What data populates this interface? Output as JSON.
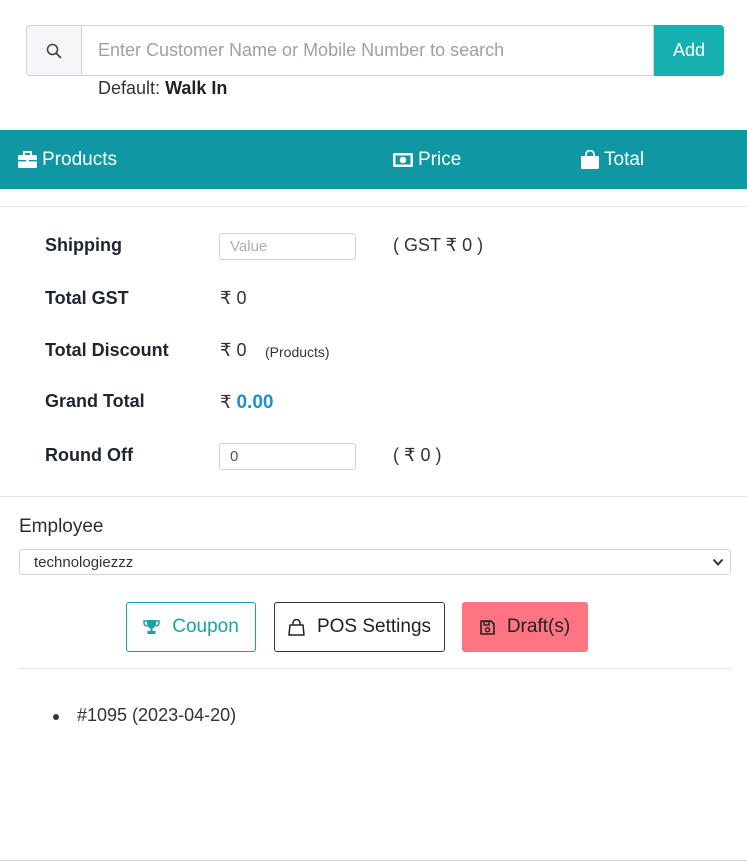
{
  "search": {
    "placeholder": "Enter Customer Name or Mobile Number to search",
    "add_label": "Add",
    "icon": "search-icon"
  },
  "customer": {
    "default_prefix": "Default:",
    "default_value": "Walk In"
  },
  "table_header": {
    "products": "Products",
    "price": "Price",
    "total": "Total",
    "background": "#0f97a3"
  },
  "summary": {
    "shipping": {
      "label": "Shipping",
      "placeholder": "Value",
      "gst_note": "( GST ₹ 0 )"
    },
    "total_gst": {
      "label": "Total GST",
      "value": "₹ 0"
    },
    "total_discount": {
      "label": "Total Discount",
      "value": "₹ 0",
      "note": "(Products)"
    },
    "grand_total": {
      "label": "Grand Total",
      "currency": "₹",
      "value": "0.00"
    },
    "round_off": {
      "label": "Round Off",
      "value": "0",
      "note": "( ₹ 0 )"
    }
  },
  "employee": {
    "label": "Employee",
    "selected": "technologiezzz"
  },
  "actions": {
    "coupon": "Coupon",
    "pos_settings": "POS Settings",
    "drafts": "Draft(s)"
  },
  "drafts": [
    {
      "text": "#1095 (2023-04-20)"
    }
  ],
  "colors": {
    "accent": "#17b0b1",
    "grand_total": "#1f8fd0",
    "draft_button": "#ff7483"
  }
}
